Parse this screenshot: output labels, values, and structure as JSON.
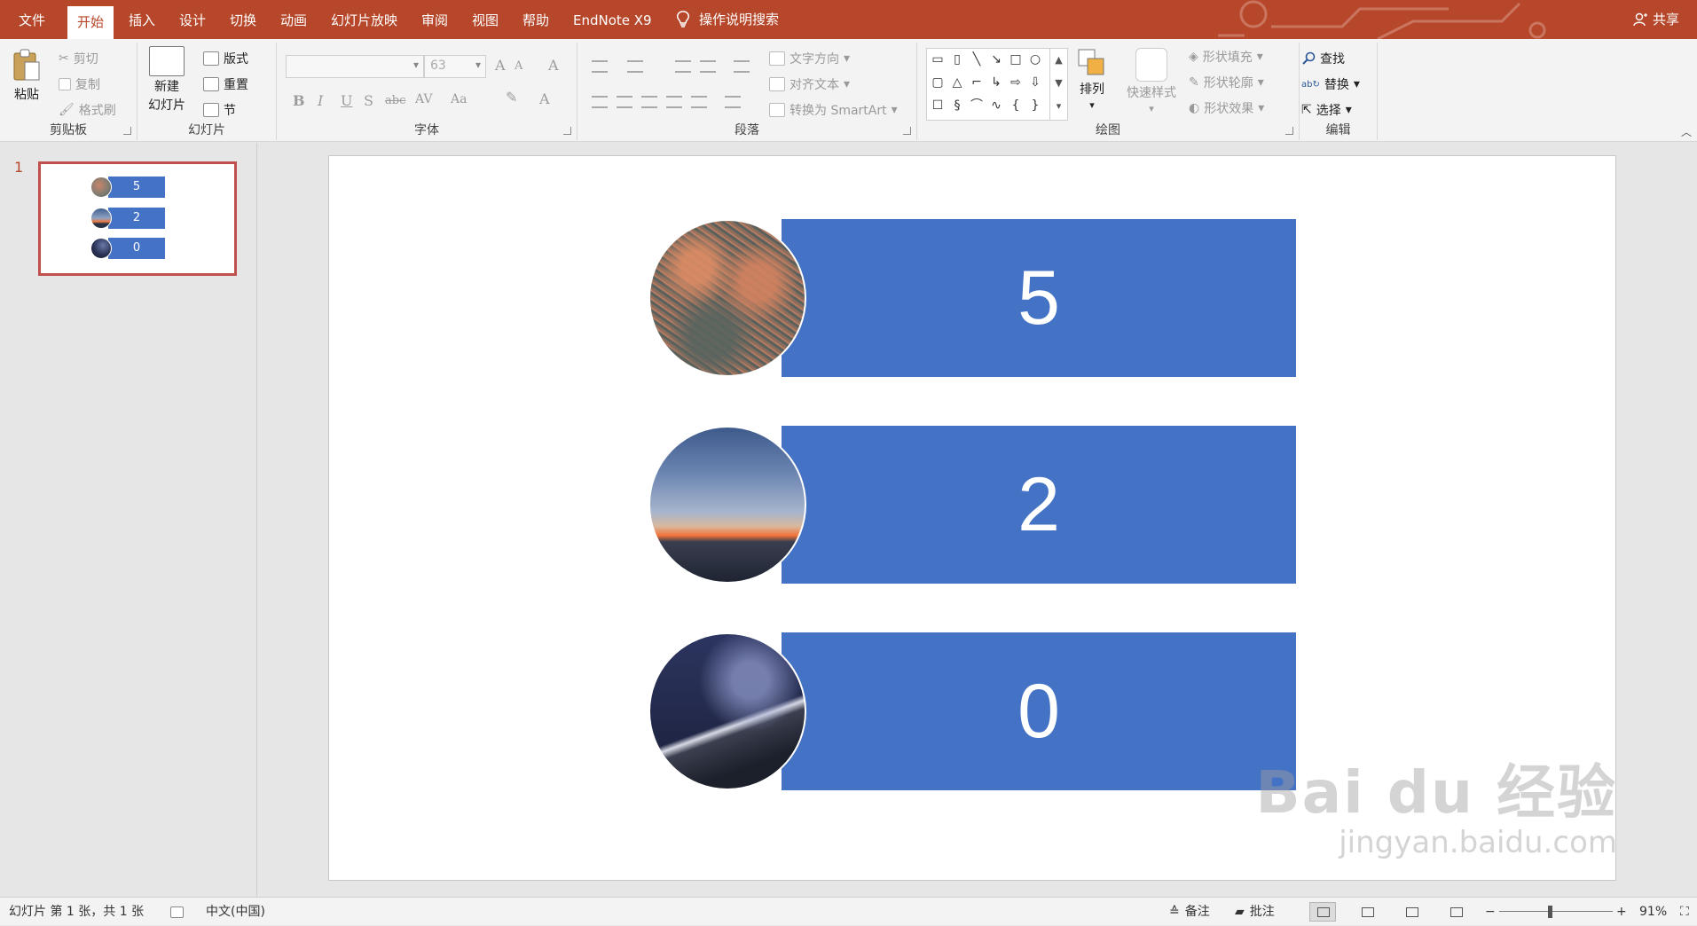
{
  "menu": {
    "tabs": [
      "文件",
      "开始",
      "插入",
      "设计",
      "切换",
      "动画",
      "幻灯片放映",
      "审阅",
      "视图",
      "帮助",
      "EndNote X9"
    ],
    "active_tab": "开始",
    "tell_me": "操作说明搜索",
    "share": "共享"
  },
  "ribbon": {
    "clipboard": {
      "label": "剪贴板",
      "paste": "粘贴",
      "cut": "剪切",
      "copy": "复制",
      "format_painter": "格式刷"
    },
    "slides": {
      "label": "幻灯片",
      "new_slide_line1": "新建",
      "new_slide_line2": "幻灯片",
      "layout": "版式",
      "reset": "重置",
      "section": "节"
    },
    "font": {
      "label": "字体",
      "font_name": "",
      "font_size": "63",
      "bold": "B",
      "italic": "I",
      "underline": "U",
      "shadow": "S",
      "strike": "abc",
      "spacing": "AV",
      "case": "Aa",
      "grow": "A",
      "shrink": "A",
      "clear": "A",
      "font_color": "A"
    },
    "paragraph": {
      "label": "段落",
      "text_direction": "文字方向",
      "align_text": "对齐文本",
      "convert_smartart": "转换为 SmartArt"
    },
    "drawing": {
      "label": "绘图",
      "arrange": "排列",
      "quick_styles": "快速样式",
      "shape_fill": "形状填充",
      "shape_outline": "形状轮廓",
      "shape_effects": "形状效果"
    },
    "editing": {
      "label": "编辑",
      "find": "查找",
      "replace": "替换",
      "select": "选择"
    }
  },
  "thumbnails": {
    "slide_number": "1",
    "rows": [
      {
        "value": "5"
      },
      {
        "value": "2"
      },
      {
        "value": "0"
      }
    ]
  },
  "slide": {
    "rows": [
      {
        "value": "5",
        "photo": "dry grass"
      },
      {
        "value": "2",
        "photo": "sunset horizon"
      },
      {
        "value": "0",
        "photo": "starry night mountain"
      }
    ],
    "banner_color": "#4472c4"
  },
  "watermark": {
    "line1": "Bai du 经验",
    "line2": "jingyan.baidu.com"
  },
  "statusbar": {
    "slide_info": "幻灯片 第 1 张，共 1 张",
    "language": "中文(中国)",
    "notes": "备注",
    "comments": "批注",
    "zoom": "91%",
    "zoom_minus": "−",
    "zoom_plus": "+"
  },
  "colors": {
    "accent": "#b7472a",
    "banner": "#4472c4"
  }
}
